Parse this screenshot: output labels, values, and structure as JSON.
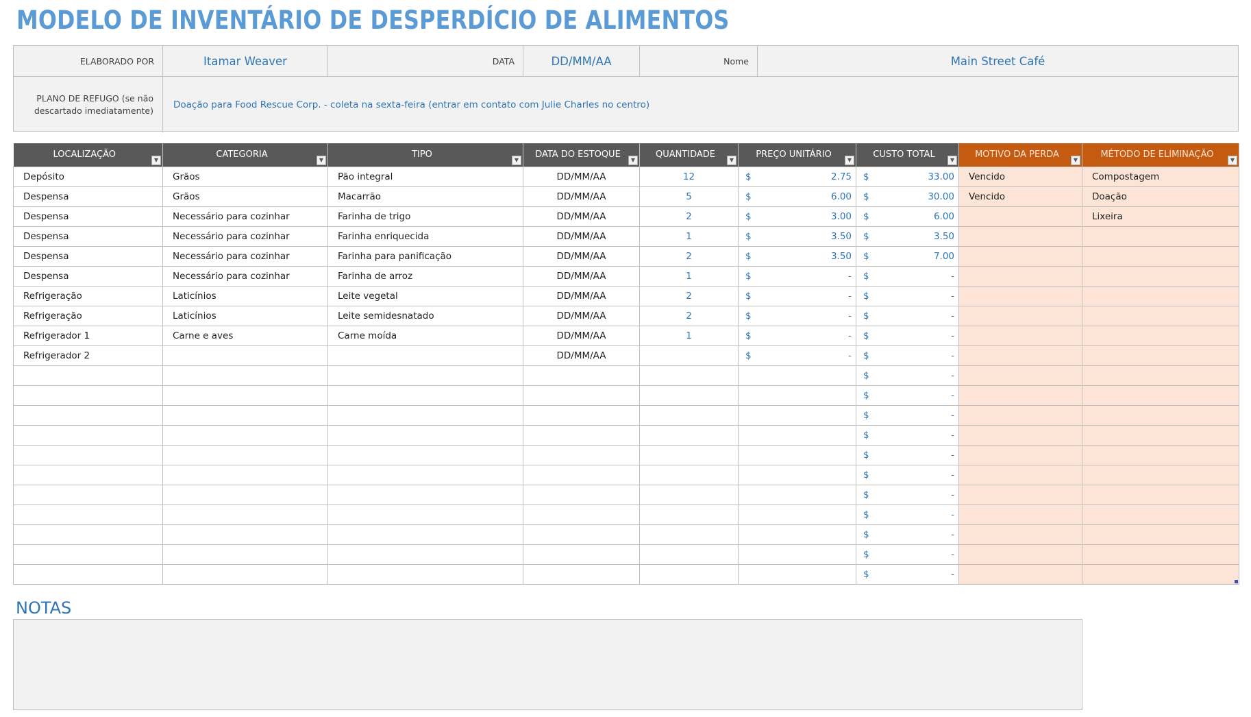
{
  "title": "MODELO DE INVENTÁRIO DE DESPERDÍCIO DE ALIMENTOS",
  "info": {
    "elaborado_por_label": "ELABORADO POR",
    "elaborado_por_value": "Itamar Weaver",
    "data_label": "DATA",
    "data_value": "DD/MM/AA",
    "nome_label": "Nome",
    "nome_value": "Main Street Café",
    "plano_label_line1": "PLANO DE REFUGO (se não",
    "plano_label_line2": "descartado imediatamente)",
    "plano_value": "Doação para Food Rescue Corp. - coleta na sexta-feira (entrar em contato com Julie Charles no centro)"
  },
  "table": {
    "headers": [
      "LOCALIZAÇÃO",
      "CATEGORIA",
      "TIPO",
      "DATA DO ESTOQUE",
      "QUANTIDADE",
      "PREÇO UNITÁRIO",
      "CUSTO TOTAL",
      "MOTIVO DA PERDA",
      "MÉTODO DE ELIMINAÇÃO"
    ],
    "filter_icon": "▼",
    "currency_symbol": "$",
    "rows": [
      {
        "localizacao": "Depósito",
        "categoria": "Grãos",
        "tipo": "Pão integral",
        "data": "DD/MM/AA",
        "quantidade": "12",
        "preco": "2.75",
        "custo": "33.00",
        "motivo": "Vencido",
        "metodo": "Compostagem"
      },
      {
        "localizacao": "Despensa",
        "categoria": "Grãos",
        "tipo": "Macarrão",
        "data": "DD/MM/AA",
        "quantidade": "5",
        "preco": "6.00",
        "custo": "30.00",
        "motivo": "Vencido",
        "metodo": "Doação"
      },
      {
        "localizacao": "Despensa",
        "categoria": "Necessário para cozinhar",
        "tipo": "Farinha de trigo",
        "data": "DD/MM/AA",
        "quantidade": "2",
        "preco": "3.00",
        "custo": "6.00",
        "motivo": "",
        "metodo": "Lixeira"
      },
      {
        "localizacao": "Despensa",
        "categoria": "Necessário para cozinhar",
        "tipo": "Farinha enriquecida",
        "data": "DD/MM/AA",
        "quantidade": "1",
        "preco": "3.50",
        "custo": "3.50",
        "motivo": "",
        "metodo": ""
      },
      {
        "localizacao": "Despensa",
        "categoria": "Necessário para cozinhar",
        "tipo": "Farinha para panificação",
        "data": "DD/MM/AA",
        "quantidade": "2",
        "preco": "3.50",
        "custo": "7.00",
        "motivo": "",
        "metodo": ""
      },
      {
        "localizacao": "Despensa",
        "categoria": "Necessário para cozinhar",
        "tipo": "Farinha de arroz",
        "data": "DD/MM/AA",
        "quantidade": "1",
        "preco": "-",
        "custo": "-",
        "motivo": "",
        "metodo": ""
      },
      {
        "localizacao": "Refrigeração",
        "categoria": "Laticínios",
        "tipo": "Leite vegetal",
        "data": "DD/MM/AA",
        "quantidade": "2",
        "preco": "-",
        "custo": "-",
        "motivo": "",
        "metodo": ""
      },
      {
        "localizacao": "Refrigeração",
        "categoria": "Laticínios",
        "tipo": "Leite semidesnatado",
        "data": "DD/MM/AA",
        "quantidade": "2",
        "preco": "-",
        "custo": "-",
        "motivo": "",
        "metodo": ""
      },
      {
        "localizacao": "Refrigerador 1",
        "categoria": "Carne e aves",
        "tipo": "Carne moída",
        "data": "DD/MM/AA",
        "quantidade": "1",
        "preco": "-",
        "custo": "-",
        "motivo": "",
        "metodo": ""
      },
      {
        "localizacao": "Refrigerador 2",
        "categoria": "",
        "tipo": "",
        "data": "DD/MM/AA",
        "quantidade": "",
        "preco": "-",
        "custo": "-",
        "motivo": "",
        "metodo": ""
      },
      {
        "localizacao": "",
        "categoria": "",
        "tipo": "",
        "data": "",
        "quantidade": "",
        "preco": null,
        "custo": "-",
        "motivo": "",
        "metodo": ""
      },
      {
        "localizacao": "",
        "categoria": "",
        "tipo": "",
        "data": "",
        "quantidade": "",
        "preco": null,
        "custo": "-",
        "motivo": "",
        "metodo": ""
      },
      {
        "localizacao": "",
        "categoria": "",
        "tipo": "",
        "data": "",
        "quantidade": "",
        "preco": null,
        "custo": "-",
        "motivo": "",
        "metodo": ""
      },
      {
        "localizacao": "",
        "categoria": "",
        "tipo": "",
        "data": "",
        "quantidade": "",
        "preco": null,
        "custo": "-",
        "motivo": "",
        "metodo": ""
      },
      {
        "localizacao": "",
        "categoria": "",
        "tipo": "",
        "data": "",
        "quantidade": "",
        "preco": null,
        "custo": "-",
        "motivo": "",
        "metodo": ""
      },
      {
        "localizacao": "",
        "categoria": "",
        "tipo": "",
        "data": "",
        "quantidade": "",
        "preco": null,
        "custo": "-",
        "motivo": "",
        "metodo": ""
      },
      {
        "localizacao": "",
        "categoria": "",
        "tipo": "",
        "data": "",
        "quantidade": "",
        "preco": null,
        "custo": "-",
        "motivo": "",
        "metodo": ""
      },
      {
        "localizacao": "",
        "categoria": "",
        "tipo": "",
        "data": "",
        "quantidade": "",
        "preco": null,
        "custo": "-",
        "motivo": "",
        "metodo": ""
      },
      {
        "localizacao": "",
        "categoria": "",
        "tipo": "",
        "data": "",
        "quantidade": "",
        "preco": null,
        "custo": "-",
        "motivo": "",
        "metodo": ""
      },
      {
        "localizacao": "",
        "categoria": "",
        "tipo": "",
        "data": "",
        "quantidade": "",
        "preco": null,
        "custo": "-",
        "motivo": "",
        "metodo": ""
      },
      {
        "localizacao": "",
        "categoria": "",
        "tipo": "",
        "data": "",
        "quantidade": "",
        "preco": null,
        "custo": "-",
        "motivo": "",
        "metodo": ""
      }
    ]
  },
  "notes": {
    "label": "NOTAS",
    "value": ""
  },
  "colors": {
    "title_blue": "#5b9bd5",
    "value_blue": "#2e75b6",
    "header_gray": "#595959",
    "header_orange": "#c55a11",
    "peach_fill": "#fce4d6",
    "panel_gray": "#f2f2f2"
  }
}
